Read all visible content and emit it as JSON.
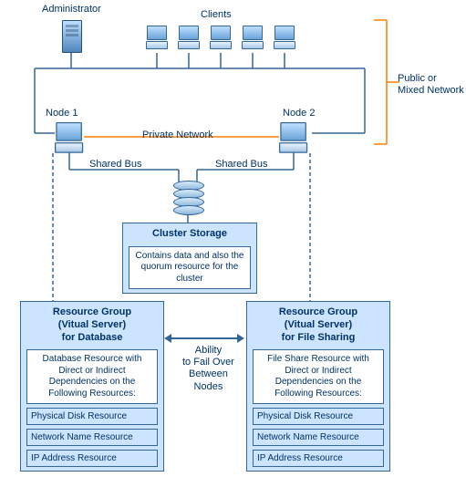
{
  "labels": {
    "administrator": "Administrator",
    "clients": "Clients",
    "public_network": "Public or\nMixed Network",
    "node1": "Node 1",
    "node2": "Node 2",
    "private_network": "Private Network",
    "shared_bus_left": "Shared Bus",
    "shared_bus_right": "Shared Bus",
    "failover": "Ability\nto Fail Over\nBetween\nNodes"
  },
  "cluster_storage": {
    "title": "Cluster Storage",
    "desc": "Contains data and also the quorum resource for the cluster"
  },
  "resource_group_db": {
    "title": "Resource Group\n(Vitual Server)\nfor Database",
    "desc": "Database Resource with Direct or Indirect Dependencies on the Following Resources:",
    "resources": [
      "Physical Disk Resource",
      "Network Name Resource",
      "IP Address Resource"
    ]
  },
  "resource_group_fs": {
    "title": "Resource Group\n(Vitual Server)\nfor File Sharing",
    "desc": "File Share Resource with Direct or Indirect Dependencies on the Following Resources:",
    "resources": [
      "Physical Disk Resource",
      "Network Name Resource",
      "IP Address Resource"
    ]
  }
}
